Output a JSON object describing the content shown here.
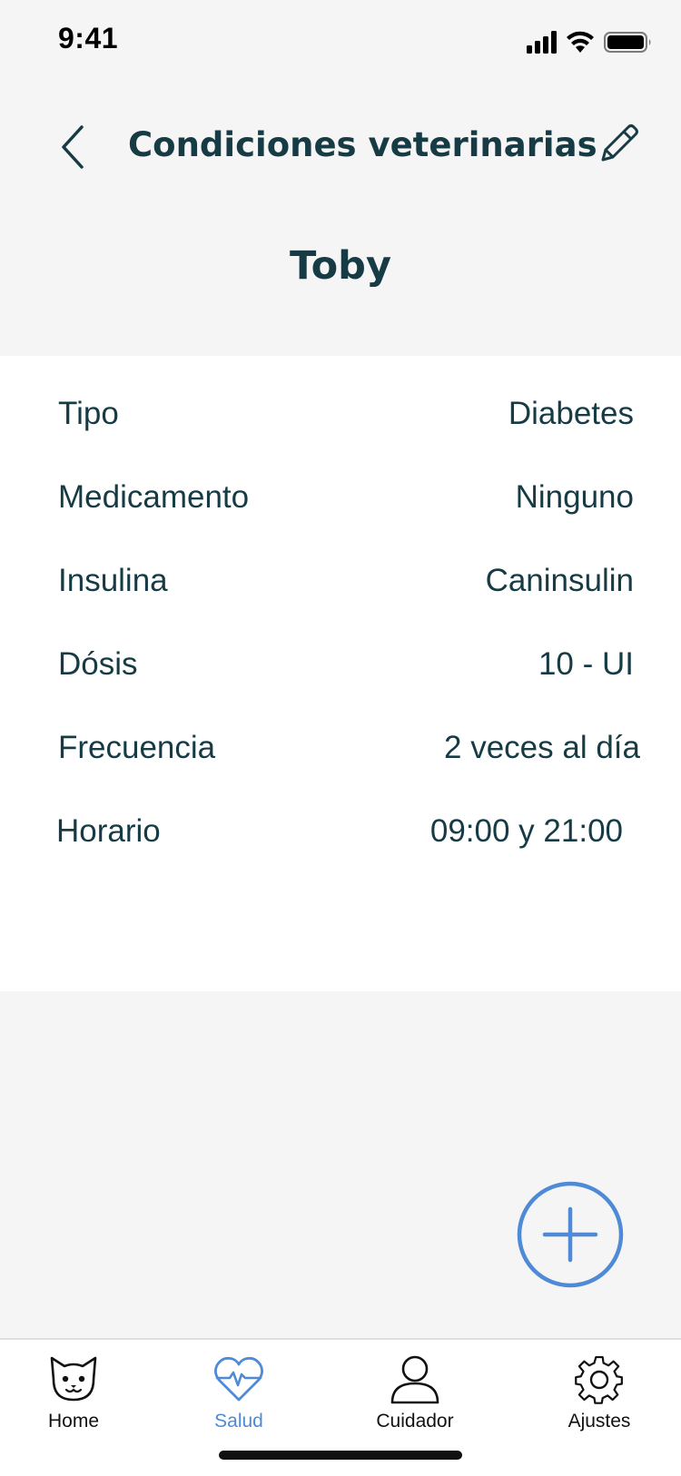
{
  "status_bar": {
    "time": "9:41"
  },
  "header": {
    "title": "Condiciones veterinarias",
    "back_icon": "chevron-left-icon",
    "edit_icon": "pencil-icon"
  },
  "pet": {
    "name": "Toby"
  },
  "details": [
    {
      "label": "Tipo",
      "value": "Diabetes"
    },
    {
      "label": "Medicamento",
      "value": "Ninguno"
    },
    {
      "label": "Insulina",
      "value": "Caninsulin"
    },
    {
      "label": "Dósis",
      "value": "10 - UI"
    },
    {
      "label": "Frecuencia",
      "value": "2 veces al día"
    },
    {
      "label": "Horario",
      "value": "09:00 y 21:00"
    }
  ],
  "fab": {
    "icon": "plus-icon"
  },
  "tabs": [
    {
      "label": "Home",
      "icon": "cat-icon",
      "active": false
    },
    {
      "label": "Salud",
      "icon": "heart-pulse-icon",
      "active": true
    },
    {
      "label": "Cuidador",
      "icon": "person-icon",
      "active": false
    },
    {
      "label": "Ajustes",
      "icon": "gear-icon",
      "active": false
    }
  ],
  "colors": {
    "primary_text": "#163b44",
    "accent": "#4f8ad6",
    "background": "#f5f5f5",
    "card": "#ffffff"
  }
}
